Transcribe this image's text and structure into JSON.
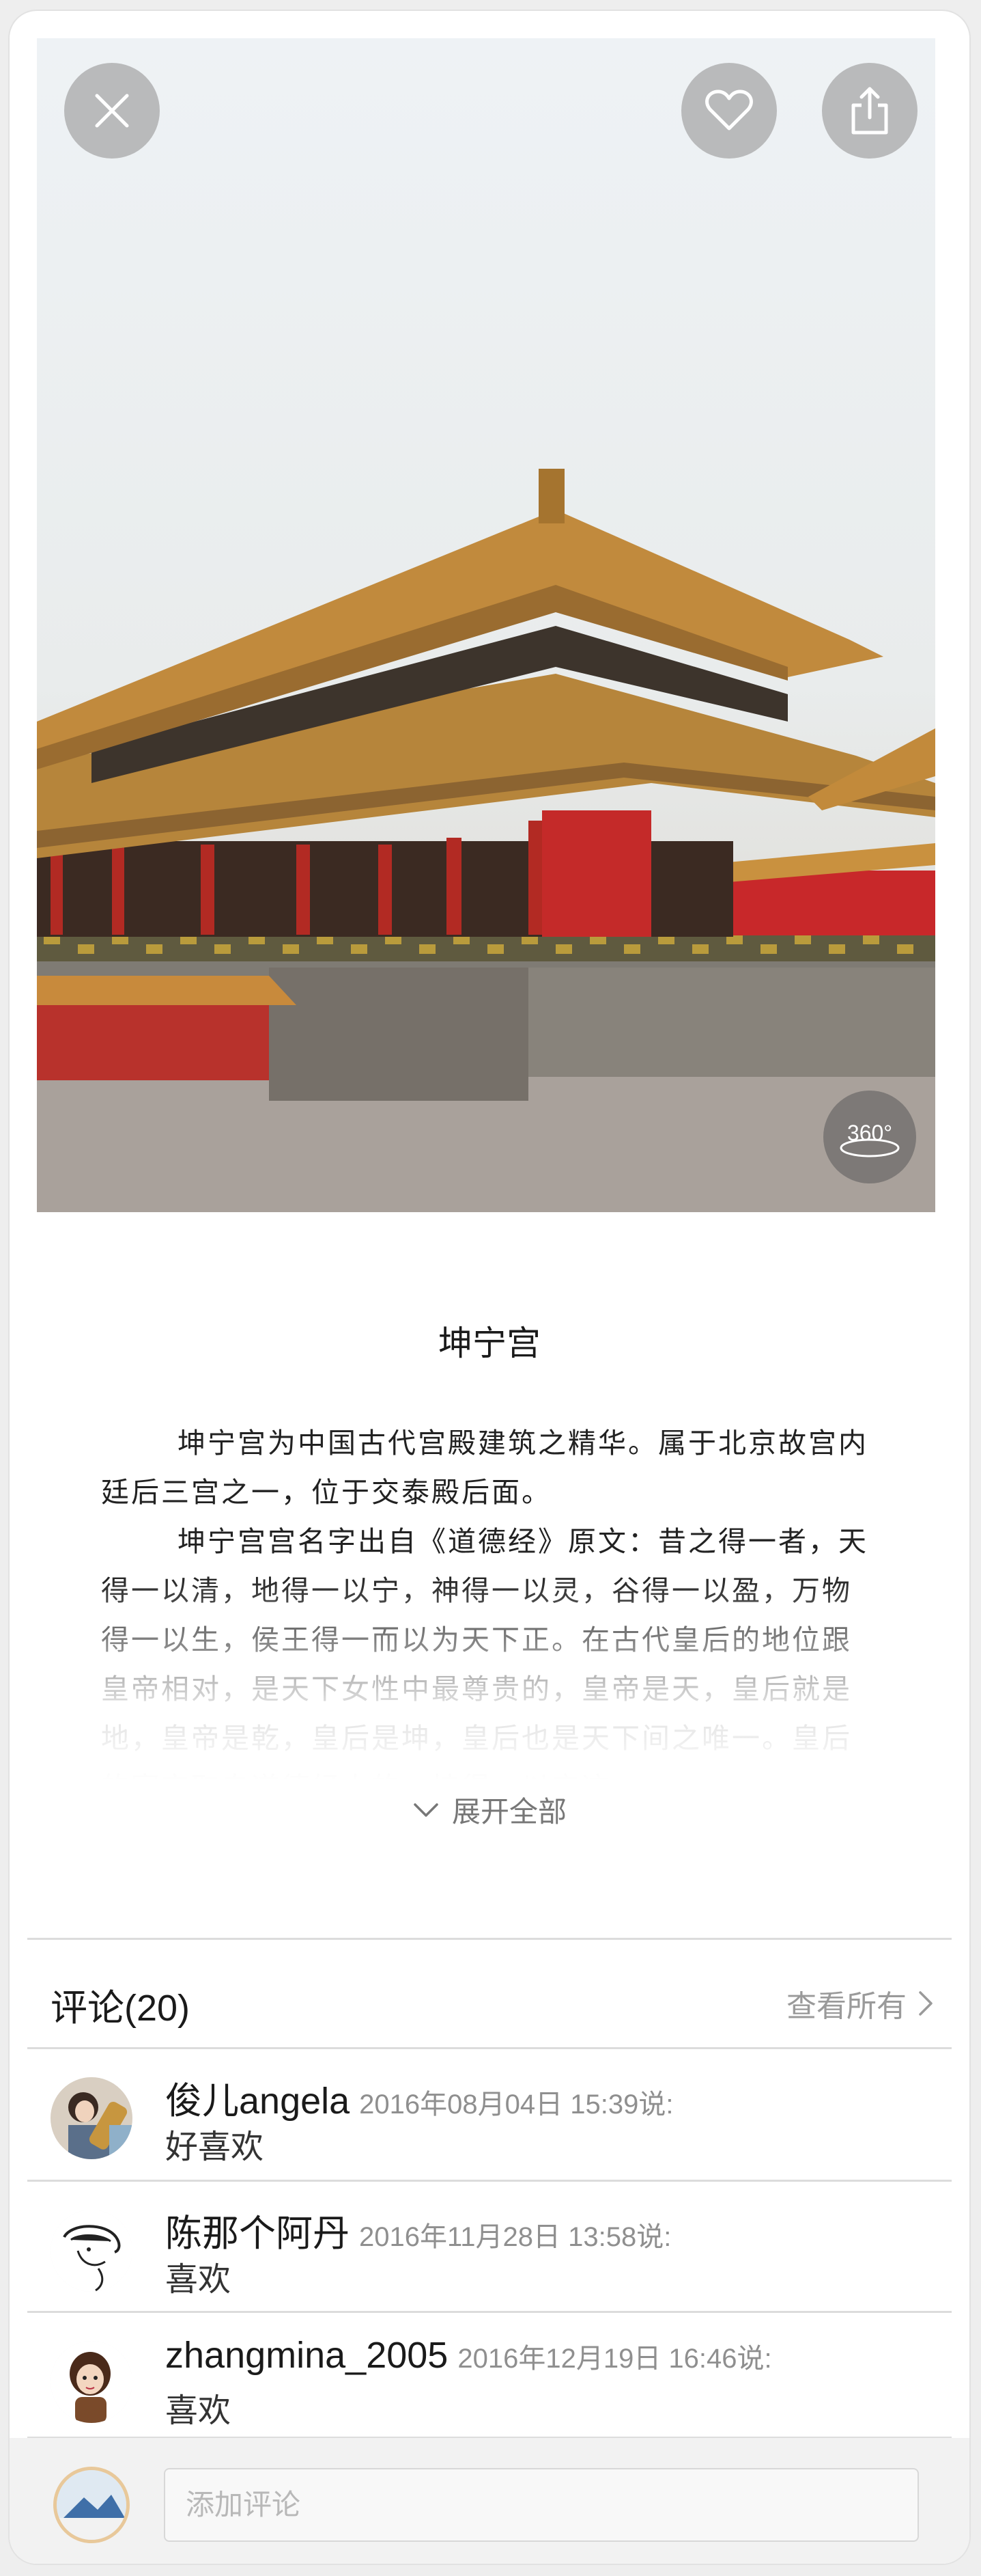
{
  "header": {
    "close_icon": "close-icon",
    "like_icon": "heart-icon",
    "share_icon": "share-icon",
    "panorama_label": "360°"
  },
  "place": {
    "title": "坤宁宫",
    "description": [
      "坤宁宫为中国古代宫殿建筑之精华。属于北京故宫内廷后三宫之一，位于交泰殿后面。",
      "坤宁宫宫名字出自《道德经》原文：昔之得一者，天得一以清，地得一以宁，神得一以灵，谷得一以盈，万物得一以生，侯王得一而以为天下正。在古代皇后的地位跟皇帝相对，是天下女性中最尊贵的，皇帝是天，皇后就是地，皇帝是乾，皇后是坤，皇后也是天下间之唯一。皇后的寝宫取自道德经中的，坤得一以宁这一"
    ],
    "expand_label": "展开全部"
  },
  "comments": {
    "header": "评论(20)",
    "view_all": "查看所有",
    "items": [
      {
        "user": "俊儿angela",
        "time": "2016年08月04日 15:39说:",
        "text": "好喜欢"
      },
      {
        "user": "陈那个阿丹",
        "time": "2016年11月28日 13:58说:",
        "text": "喜欢"
      },
      {
        "user": "zhangmina_2005",
        "time": "2016年12月19日 16:46说:",
        "text": "喜欢"
      }
    ]
  },
  "composer": {
    "placeholder": "添加评论",
    "value": ""
  },
  "colors": {
    "wall_red": "#c8282a",
    "roof_gold": "#c9913f",
    "text_muted": "#8f8f8f"
  }
}
